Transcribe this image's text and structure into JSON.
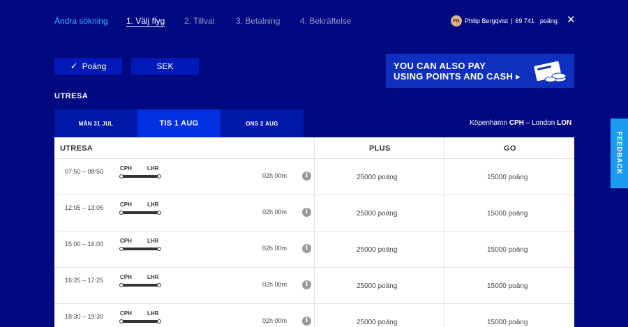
{
  "nav": {
    "back": "Ändra sökning",
    "steps": [
      "1. Välj flyg",
      "2. Tillval",
      "3. Betalning",
      "4. Bekräftelse"
    ]
  },
  "user": {
    "initials": "PB",
    "name": "Philip Bergqvist",
    "points": "69 741",
    "unit": "poäng"
  },
  "close_glyph": "✕",
  "currency": {
    "points_label": "Poäng",
    "sek_label": "SEK"
  },
  "banner": {
    "line1": "YOU CAN ALSO PAY",
    "line2": "USING POINTS AND CASH ▸"
  },
  "section_title": "UTRESA",
  "dates": [
    "MÅN 31 JUL",
    "TIS 1 AUG",
    "ONS 2 AUG"
  ],
  "route": {
    "from_city": "Köpenhamn",
    "from_code": "CPH",
    "sep": "–",
    "to_city": "London",
    "to_code": "LON"
  },
  "table": {
    "headers": [
      "UTRESA",
      "PLUS",
      "GO"
    ],
    "rows": [
      {
        "time": "07:50 – 08:50",
        "from": "CPH",
        "to": "LHR",
        "duration": "02h 00m",
        "plus": "25000 poäng",
        "go": "15000 poäng"
      },
      {
        "time": "12:05 – 13:05",
        "from": "CPH",
        "to": "LHR",
        "duration": "02h 00m",
        "plus": "25000 poäng",
        "go": "15000 poäng"
      },
      {
        "time": "15:00 – 16:00",
        "from": "CPH",
        "to": "LHR",
        "duration": "02h 00m",
        "plus": "25000 poäng",
        "go": "15000 poäng"
      },
      {
        "time": "16:25 – 17:25",
        "from": "CPH",
        "to": "LHR",
        "duration": "02h 00m",
        "plus": "25000 poäng",
        "go": "15000 poäng"
      },
      {
        "time": "18:30 – 19:30",
        "from": "CPH",
        "to": "LHR",
        "duration": "02h 00m",
        "plus": "25000 poäng",
        "go": "15000 poäng"
      }
    ]
  },
  "feedback": "FEEDBACK",
  "colors": {
    "background": "#000a80",
    "accent_link": "#3ab0ff",
    "button_bg": "#0019b8",
    "active_tab": "#0030e0",
    "feedback": "#1a9bf0"
  }
}
